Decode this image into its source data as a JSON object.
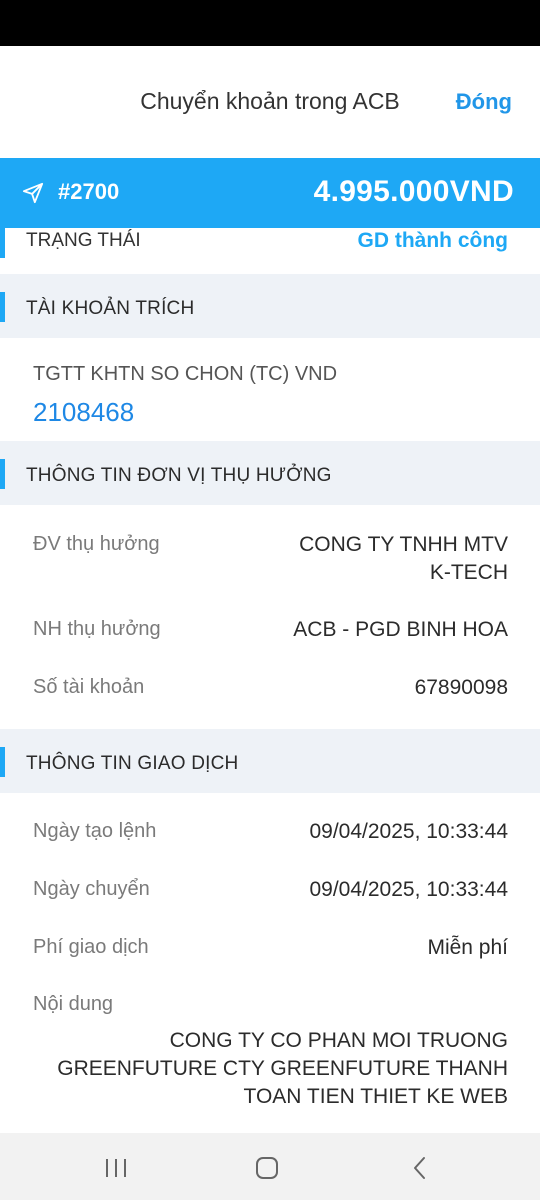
{
  "header": {
    "title": "Chuyển khoản trong ACB",
    "close_label": "Đóng"
  },
  "banner": {
    "txn_id": "#2700",
    "amount": "4.995.000",
    "currency": "VND",
    "icon": "send-icon",
    "color": "#1ea8f5"
  },
  "status": {
    "label": "TRẠNG THÁI",
    "value": "GD thành công"
  },
  "source_account": {
    "section_title": "TÀI KHOẢN TRÍCH",
    "name": "TGTT KHTN SO CHON (TC) VND",
    "number": "2108468"
  },
  "beneficiary": {
    "section_title": "THÔNG TIN ĐƠN VỊ THỤ HƯỞNG",
    "unit_label": "ĐV thụ hưởng",
    "unit_value_line1": "CONG TY TNHH MTV",
    "unit_value_line2": "K-TECH",
    "bank_label": "NH thụ hưởng",
    "bank_value": "ACB - PGD BINH HOA",
    "account_label": "Số tài khoản",
    "account_value": "67890098"
  },
  "transaction": {
    "section_title": "THÔNG TIN GIAO DỊCH",
    "created_label": "Ngày tạo lệnh",
    "created_value": "09/04/2025, 10:33:44",
    "transfer_label": "Ngày chuyển",
    "transfer_value": "09/04/2025, 10:33:44",
    "fee_label": "Phí giao dịch",
    "fee_value": "Miễn phí",
    "content_label": "Nội dung",
    "content_line1": "CONG TY CO PHAN MOI TRUONG",
    "content_line2": "GREENFUTURE CTY GREENFUTURE THANH",
    "content_line3": "TOAN TIEN THIET KE WEB"
  },
  "nav": {
    "recents_icon": "recents-icon",
    "home_icon": "home-icon",
    "back_icon": "back-icon"
  }
}
